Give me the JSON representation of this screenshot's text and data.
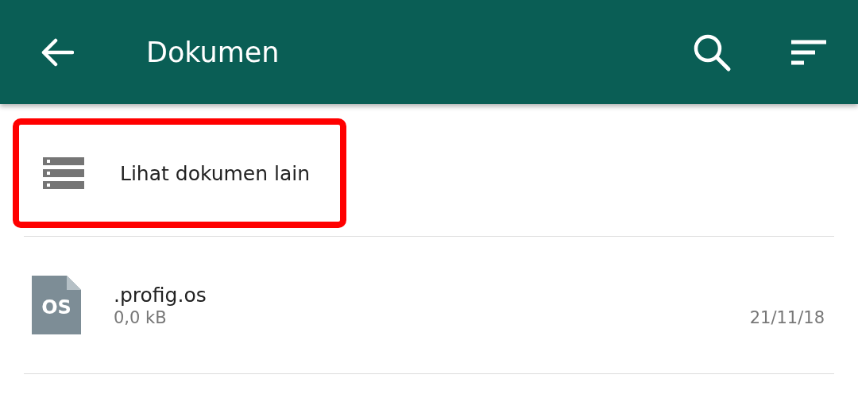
{
  "app_bar": {
    "title": "Dokumen"
  },
  "browse_item": {
    "label": "Lihat dokumen lain",
    "highlighted": true
  },
  "files": [
    {
      "name": ".profig.os",
      "badge": "OS",
      "size": "0,0 kB",
      "date": "21/11/18"
    }
  ]
}
